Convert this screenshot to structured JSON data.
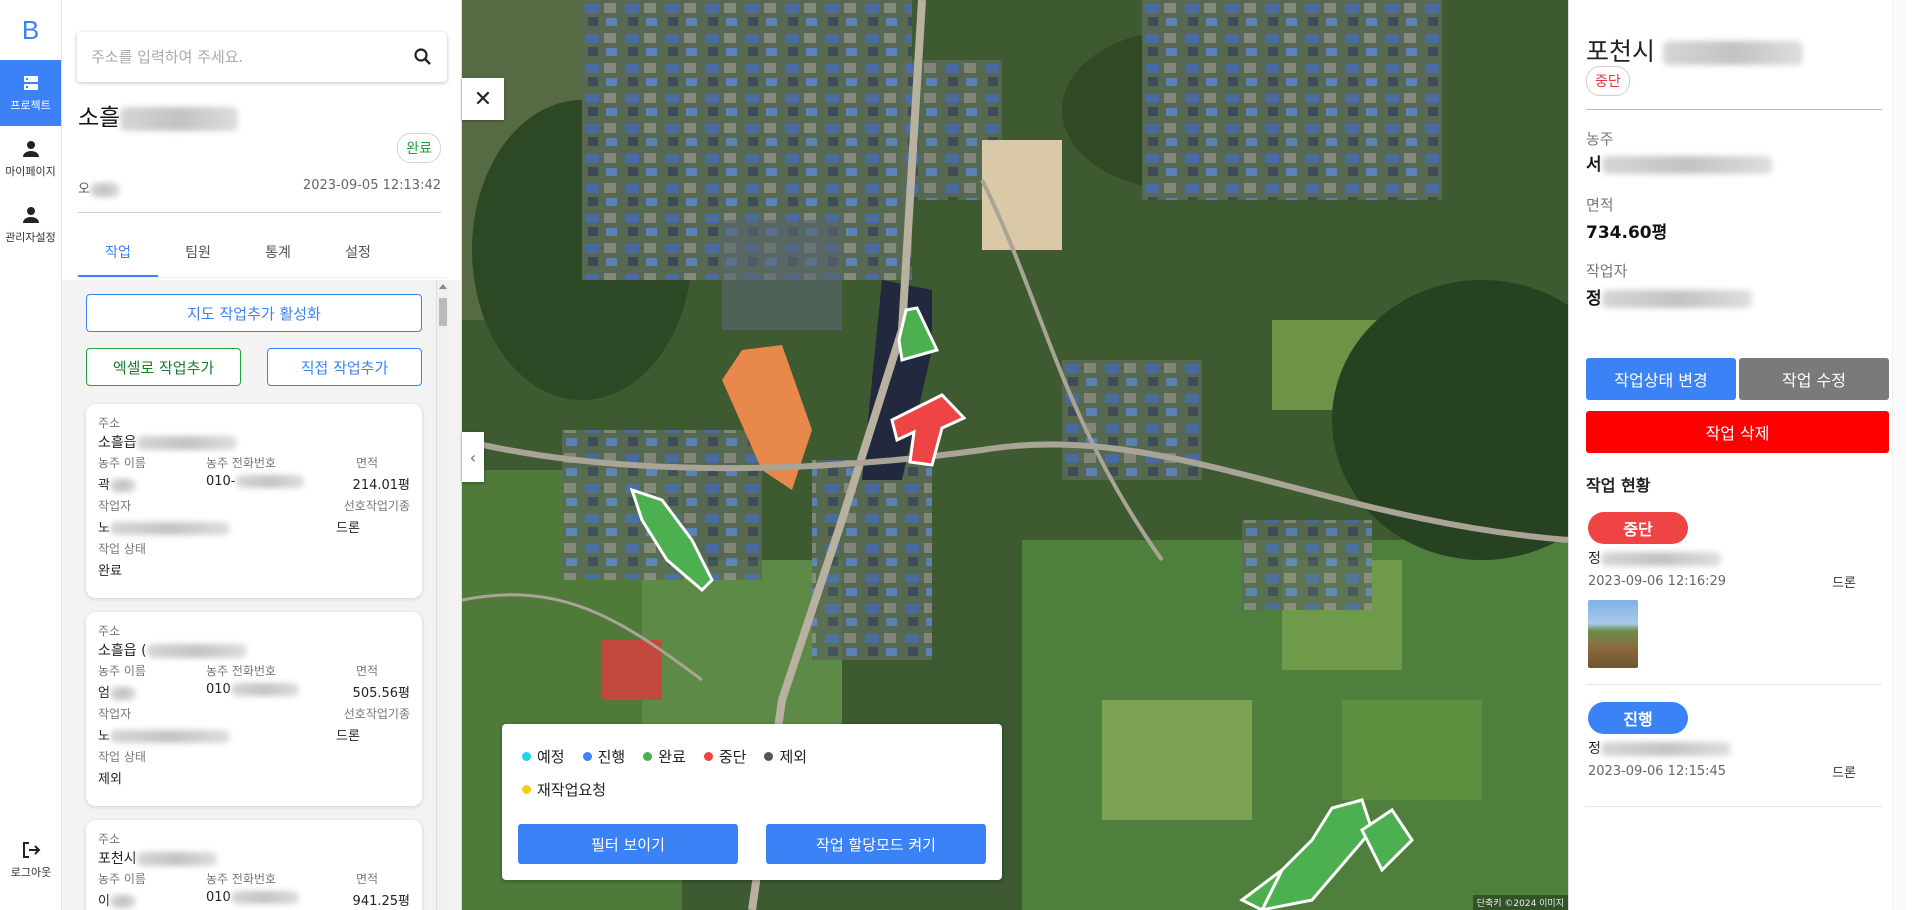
{
  "rail": {
    "logo": "B",
    "items": [
      {
        "label": "프로젝트",
        "icon": "project-icon",
        "active": true
      },
      {
        "label": "마이페이지",
        "icon": "person-icon"
      },
      {
        "label": "관리자설정",
        "icon": "admin-icon"
      }
    ],
    "logout_label": "로그아웃"
  },
  "panel": {
    "search_placeholder": "주소를 입력하여 주세요.",
    "project_title": "소흘",
    "project_status": "완료",
    "project_owner": "오",
    "project_date": "2023-09-05 12:13:42",
    "tabs": [
      "작업",
      "팀원",
      "통계",
      "설정"
    ],
    "buttons": {
      "map_add": "지도 작업추가 활성화",
      "excel_add": "엑셀로 작업추가",
      "direct_add": "직접 작업추가"
    },
    "labels": {
      "address": "주소",
      "owner_name": "농주 이름",
      "owner_phone": "농주 전화번호",
      "area": "면적",
      "worker": "작업자",
      "preferred_type": "선호작업기종",
      "status": "작업 상태"
    },
    "cards": [
      {
        "address": "소흘읍",
        "owner": "곽",
        "phone": "010-",
        "area": "214.01평",
        "worker": "노",
        "type": "드론",
        "status": "완료"
      },
      {
        "address": "소흘읍 (",
        "owner": "엄",
        "phone": "010",
        "area": "505.56평",
        "worker": "노",
        "type": "드론",
        "status": "제외"
      },
      {
        "address": "포천시",
        "owner": "이",
        "phone": "010",
        "area": "941.25평",
        "worker": "",
        "type": "",
        "status": ""
      }
    ]
  },
  "map": {
    "legend": [
      {
        "label": "예정",
        "color": "#22d3ee"
      },
      {
        "label": "진행",
        "color": "#3b82f6"
      },
      {
        "label": "완료",
        "color": "#4caf50"
      },
      {
        "label": "중단",
        "color": "#ef4444"
      },
      {
        "label": "제외",
        "color": "#555555"
      },
      {
        "label": "재작업요청",
        "color": "#facc15"
      }
    ],
    "filter_button": "필터 보이기",
    "assign_button": "작업 할당모드 켜기",
    "attribution": "단축키 ©2024 이미지"
  },
  "detail": {
    "title": "포천시",
    "status": "중단",
    "owner_label": "농주",
    "owner_value": "서",
    "area_label": "면적",
    "area_value": "734.60평",
    "worker_label": "작업자",
    "worker_value": "정",
    "change_status": "작업상태 변경",
    "edit": "작업 수정",
    "delete": "작업 삭제",
    "history_title": "작업 현황",
    "history": [
      {
        "status": "중단",
        "color": "#ef4444",
        "name": "정",
        "date": "2023-09-06 12:16:29",
        "type": "드론"
      },
      {
        "status": "진행",
        "color": "#3b82f6",
        "name": "정",
        "date": "2023-09-06 12:15:45",
        "type": "드론"
      }
    ]
  }
}
